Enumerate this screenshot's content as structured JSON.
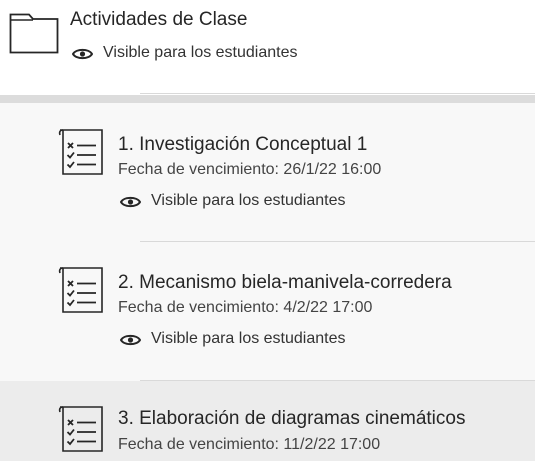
{
  "folder": {
    "title": "Actividades de Clase",
    "visibility": "Visible para los estudiantes"
  },
  "items": [
    {
      "title": "1. Investigación Conceptual 1",
      "due": "Fecha de vencimiento: 26/1/22 16:00",
      "visibility": "Visible para los estudiantes"
    },
    {
      "title": "2. Mecanismo biela-manivela-corredera",
      "due": "Fecha de vencimiento: 4/2/22 17:00",
      "visibility": "Visible para los estudiantes"
    },
    {
      "title": "3. Elaboración de diagramas cinemáticos",
      "due": "Fecha de vencimiento: 11/2/22 17:00"
    }
  ],
  "icons": {
    "folder": "folder-icon",
    "visibility": "eye-icon",
    "assignment": "checklist-icon"
  },
  "colors": {
    "text": "#262626",
    "band": "#dcdcdc",
    "list_background": "#f8f8f8",
    "hover_background": "#ececec"
  }
}
